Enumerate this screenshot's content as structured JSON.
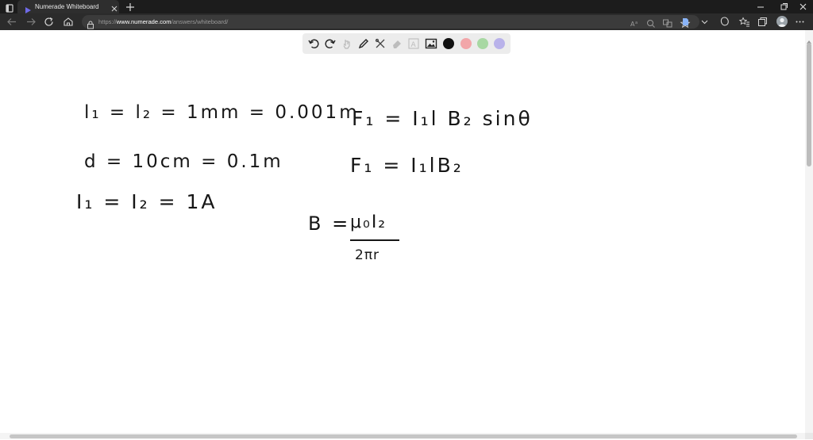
{
  "browser": {
    "tab_title": "Numerade Whiteboard",
    "url_scheme": "https://",
    "url_host": "www.numerade.com",
    "url_path": "/answers/whiteboard/"
  },
  "toolbar": {
    "tools": [
      "undo-icon",
      "redo-icon",
      "pointer-icon",
      "pen-icon",
      "tools-icon",
      "eraser-icon",
      "text-icon",
      "image-icon"
    ],
    "colors": [
      {
        "name": "black",
        "hex": "#111111",
        "selected": true
      },
      {
        "name": "red",
        "hex": "#f2a6a9"
      },
      {
        "name": "green",
        "hex": "#a8d8a3"
      },
      {
        "name": "purple",
        "hex": "#b9b2ea"
      }
    ]
  },
  "whiteboard": {
    "eq_lengths": "l₁ = l₂ = 1mm = 0.001m",
    "eq_distance": "d = 10cm = 0.1m",
    "eq_currents": "I₁ = I₂ = 1A",
    "eq_force_full": "F₁ = I₁l B₂ sinθ",
    "eq_force": "F₁ = I₁lB₂",
    "eq_field_lhs": "B =",
    "eq_field_num": "μ₀I₂",
    "eq_field_den": "2πr"
  },
  "colors": {
    "tabbar_bg": "#1c1c1c",
    "addressbar_bg": "#2b2b2b",
    "toolbar_bg": "#ececec",
    "ink": "#161616"
  }
}
